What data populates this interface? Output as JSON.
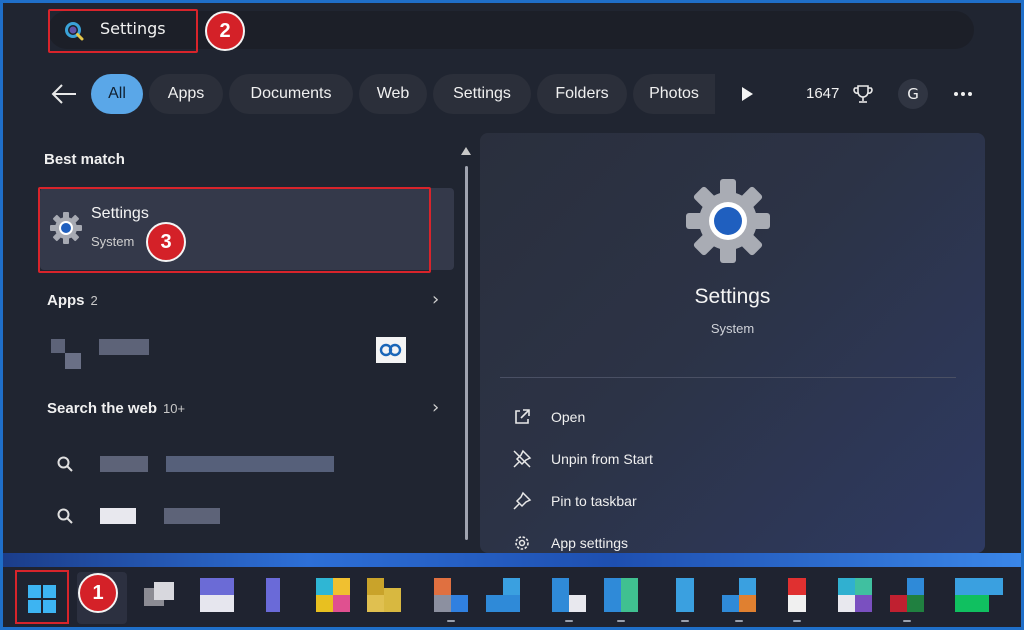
{
  "search": {
    "query": "Settings",
    "step_label": "2"
  },
  "filters": {
    "chips": [
      {
        "label": "All",
        "active": true
      },
      {
        "label": "Apps"
      },
      {
        "label": "Documents"
      },
      {
        "label": "Web"
      },
      {
        "label": "Settings"
      },
      {
        "label": "Folders"
      },
      {
        "label": "Photos"
      }
    ],
    "points": "1647",
    "avatar_initial": "G",
    "more_icon": "more-dots-icon",
    "play_icon": "play-triangle-icon",
    "trophy_icon": "trophy-icon"
  },
  "results": {
    "best_match_title": "Best match",
    "best_match": {
      "title": "Settings",
      "subtitle": "System",
      "icon": "gear-icon",
      "step_label": "3"
    },
    "apps_title": "Apps",
    "apps_count": "2",
    "web_title": "Search the web",
    "web_count": "10+"
  },
  "preview": {
    "title": "Settings",
    "subtitle": "System",
    "actions": [
      {
        "label": "Open",
        "icon": "open-external-icon"
      },
      {
        "label": "Unpin from Start",
        "icon": "unpin-icon"
      },
      {
        "label": "Pin to taskbar",
        "icon": "pin-icon"
      },
      {
        "label": "App settings",
        "icon": "gear-icon"
      }
    ]
  },
  "taskbar": {
    "start_icon": "windows-logo-icon",
    "step_label": "1"
  },
  "colors": {
    "accent": "#5aa7e8",
    "highlight_red": "#d8242b",
    "frame_blue": "#1f6fc9",
    "panel_bg": "#202531"
  }
}
